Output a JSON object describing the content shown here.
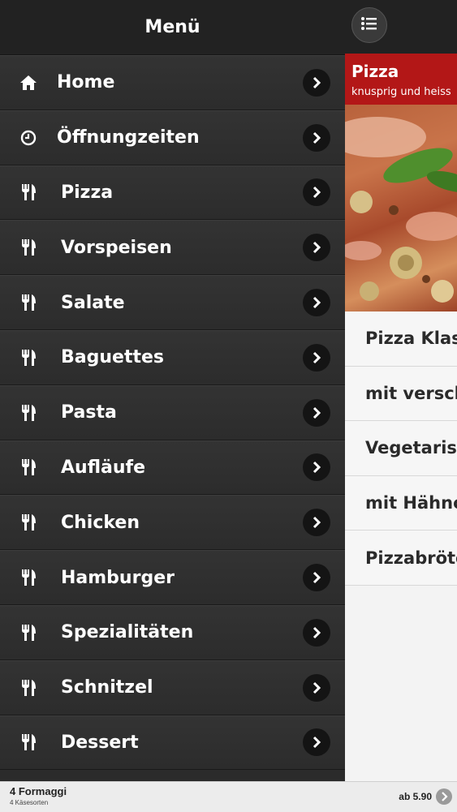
{
  "menu": {
    "title": "Menü",
    "items": [
      {
        "label": "Home",
        "icon": "home-icon"
      },
      {
        "label": "Öffnungzeiten",
        "icon": "clock-icon"
      },
      {
        "label": "Pizza",
        "icon": "cutlery-icon"
      },
      {
        "label": "Vorspeisen",
        "icon": "cutlery-icon"
      },
      {
        "label": "Salate",
        "icon": "cutlery-icon"
      },
      {
        "label": "Baguettes",
        "icon": "cutlery-icon"
      },
      {
        "label": "Pasta",
        "icon": "cutlery-icon"
      },
      {
        "label": "Aufläufe",
        "icon": "cutlery-icon"
      },
      {
        "label": "Chicken",
        "icon": "cutlery-icon"
      },
      {
        "label": "Hamburger",
        "icon": "cutlery-icon"
      },
      {
        "label": "Spezialitäten",
        "icon": "cutlery-icon"
      },
      {
        "label": "Schnitzel",
        "icon": "cutlery-icon"
      },
      {
        "label": "Dessert",
        "icon": "cutlery-icon"
      }
    ]
  },
  "content": {
    "banner_title": "Pizza",
    "banner_subtitle": "knusprig und heiss",
    "categories": [
      "Pizza Klas",
      "mit versch",
      "Vegetarisc",
      "mit Hähnc",
      "Pizzabröte"
    ]
  },
  "bottom_bar": {
    "item_name": "4 Formaggi",
    "item_desc": "4 Käsesorten",
    "price": "ab 5.90"
  },
  "colors": {
    "menu_bg": "#2b2b2b",
    "header_bg": "#222222",
    "banner_red": "#b31717"
  }
}
